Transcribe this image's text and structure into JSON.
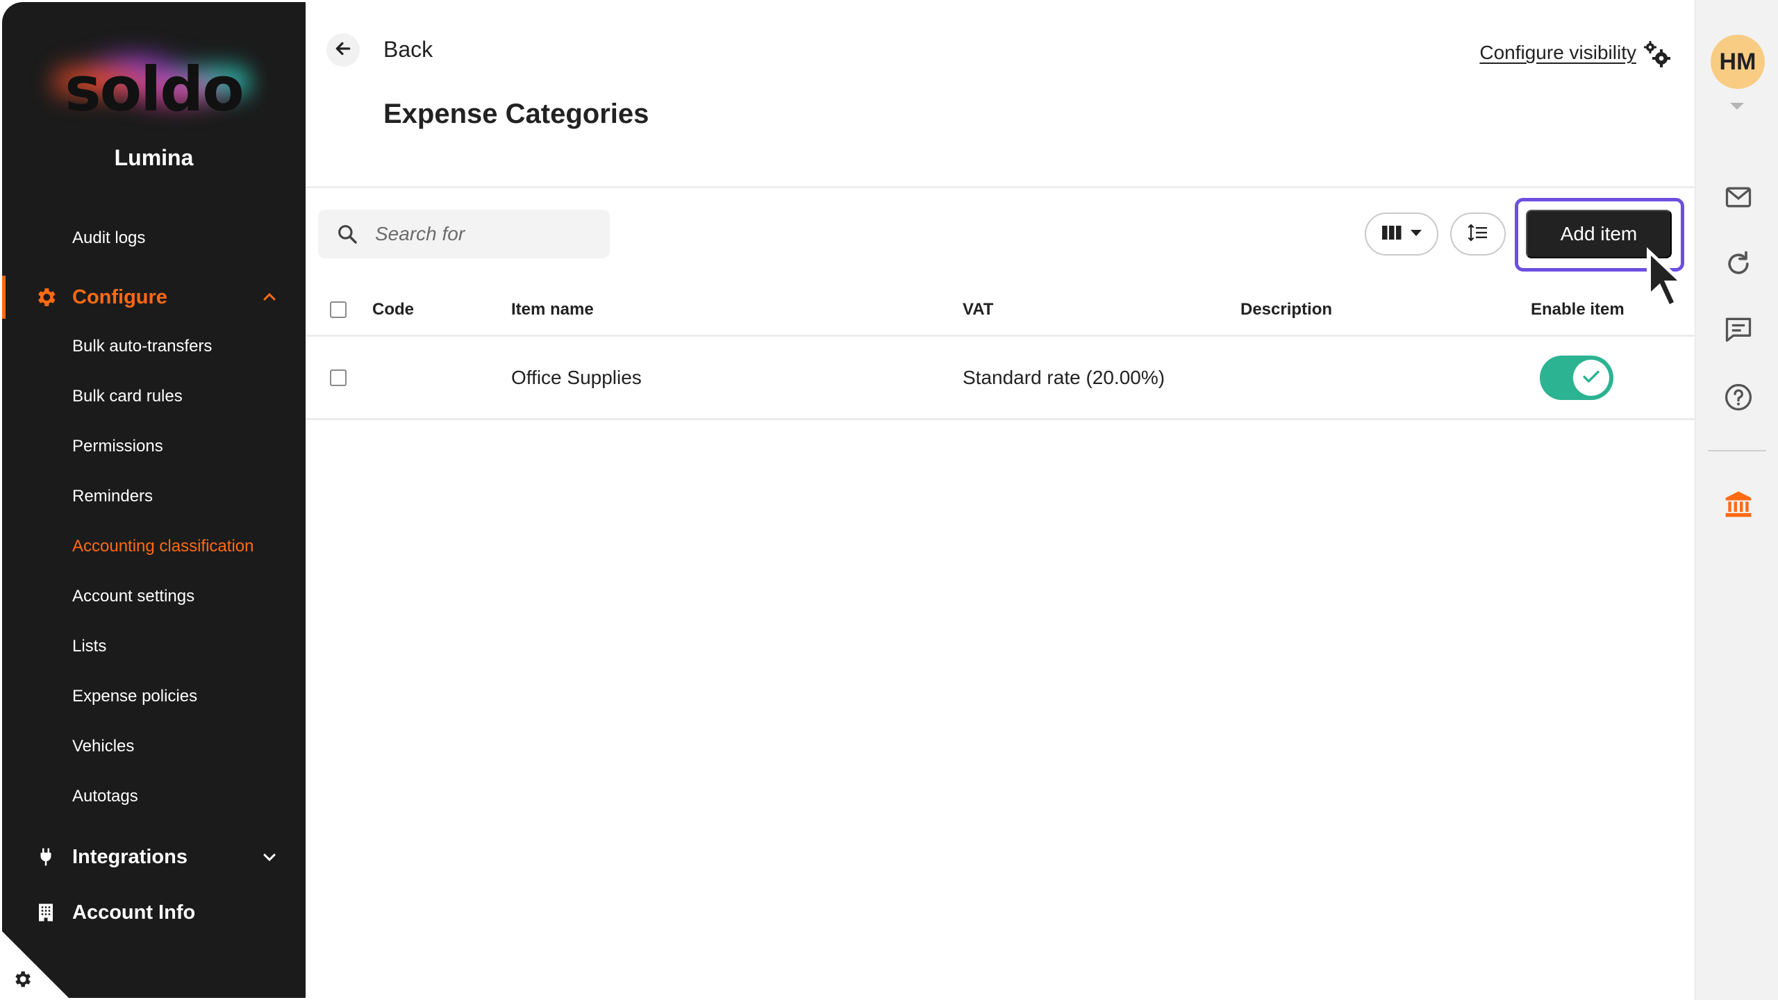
{
  "brand": {
    "logo_text": "soldo",
    "org_name": "Lumina",
    "accent": "#ff6a13"
  },
  "sidebar": {
    "top_items": [
      {
        "label": "Audit logs"
      }
    ],
    "configure": {
      "label": "Configure",
      "items": [
        {
          "label": "Bulk auto-transfers"
        },
        {
          "label": "Bulk card rules"
        },
        {
          "label": "Permissions"
        },
        {
          "label": "Reminders"
        },
        {
          "label": "Accounting classification",
          "active": true
        },
        {
          "label": "Account settings"
        },
        {
          "label": "Lists"
        },
        {
          "label": "Expense policies"
        },
        {
          "label": "Vehicles"
        },
        {
          "label": "Autotags"
        }
      ]
    },
    "integrations": {
      "label": "Integrations"
    },
    "account_info": {
      "label": "Account Info"
    }
  },
  "header": {
    "back_label": "Back",
    "title": "Expense Categories",
    "configure_visibility": "Configure visibility"
  },
  "toolbar": {
    "search_placeholder": "Search for",
    "add_item_label": "Add item"
  },
  "table": {
    "columns": [
      "Code",
      "Item name",
      "VAT",
      "Description",
      "Enable item"
    ],
    "rows": [
      {
        "code": "",
        "item_name": "Office Supplies",
        "vat": "Standard rate (20.00%)",
        "description": "",
        "enabled": true
      }
    ]
  },
  "user": {
    "initials": "HM",
    "avatar_color": "#f9cc84"
  },
  "rail_icons": [
    "mail-icon",
    "refresh-icon",
    "chat-icon",
    "help-icon",
    "bank-icon"
  ]
}
